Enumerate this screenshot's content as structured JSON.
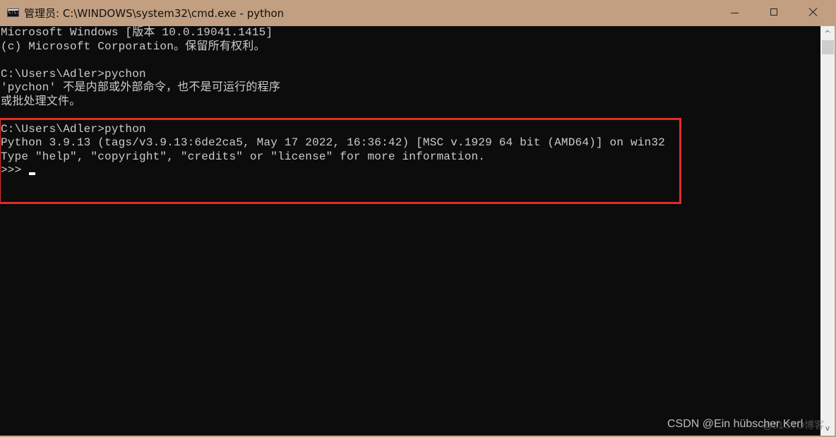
{
  "window": {
    "title": "管理员: C:\\WINDOWS\\system32\\cmd.exe - python",
    "icon": "cmd-icon",
    "icon_text": "C:\\.",
    "controls": {
      "minimize": "minimize-icon",
      "maximize": "maximize-icon",
      "close": "close-icon"
    }
  },
  "console": {
    "lines": [
      "Microsoft Windows [版本 10.0.19041.1415]",
      "(c) Microsoft Corporation。保留所有权利。",
      "",
      "C:\\Users\\Adler>pychon",
      "'pychon' 不是内部或外部命令，也不是可运行的程序",
      "或批处理文件。",
      "",
      "C:\\Users\\Adler>python",
      "Python 3.9.13 (tags/v3.9.13:6de2ca5, May 17 2022, 16:36:42) [MSC v.1929 64 bit (AMD64)] on win32",
      "Type \"help\", \"copyright\", \"credits\" or \"license\" for more information.",
      ">>> "
    ],
    "highlight_color": "#e32a2a",
    "text_color": "#cccccc",
    "background": "#0c0c0c"
  },
  "scrollbar": {
    "up_arrow": "^",
    "down_arrow": "v"
  },
  "watermark": {
    "text": "CSDN @Ein hübscher Kerl",
    "faint_text": "@51CTO博客"
  }
}
